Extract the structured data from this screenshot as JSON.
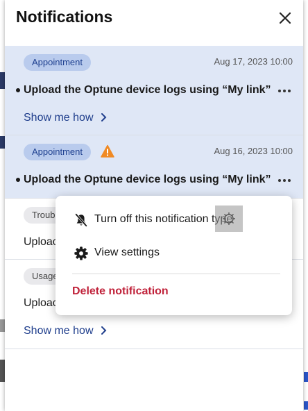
{
  "header": {
    "title": "Notifications"
  },
  "notifications": [
    {
      "tag": "Appointment",
      "date": "Aug 17, 2023 10:00",
      "message": "Upload the Optune device logs using “My link”",
      "link": "Show me how"
    },
    {
      "tag": "Appointment",
      "date": "Aug 16, 2023 10:00",
      "message": "Upload the Optune device logs using “My link”"
    },
    {
      "tag": "Troubl",
      "message": "Uploac"
    },
    {
      "tag": "Usage",
      "message": "Uploac",
      "link": "Show me how"
    }
  ],
  "context_menu": {
    "turn_off": "Turn off this notification type",
    "view_settings": "View settings",
    "delete": "Delete notification"
  },
  "colors": {
    "unread_bg": "#dfe7f6",
    "chip_blue": "#b9cbed",
    "link": "#1f3e8c",
    "danger": "#c0223a",
    "warning": "#f08a24"
  }
}
